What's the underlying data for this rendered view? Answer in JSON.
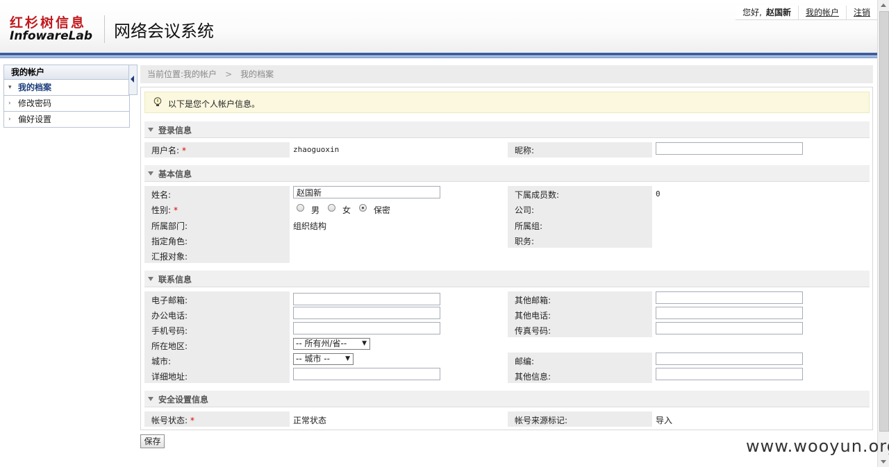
{
  "header": {
    "logo_cn": "红杉树信息",
    "logo_en": "InfowareLab",
    "system_title": "网络会议系统",
    "greeting": "您好,",
    "user_name": "赵国新",
    "my_account_link": "我的帐户",
    "logout_link": "注销"
  },
  "sidebar": {
    "title": "我的帐户",
    "items": [
      {
        "label": "我的档案",
        "active": true
      },
      {
        "label": "修改密码",
        "active": false
      },
      {
        "label": "偏好设置",
        "active": false
      }
    ]
  },
  "breadcrumb": {
    "prefix": "当前位置:",
    "level1": "我的帐户",
    "level2": "我的档案"
  },
  "notice": {
    "text": "以下是您个人帐户信息。"
  },
  "sections": {
    "login": "登录信息",
    "basic": "基本信息",
    "contact": "联系信息",
    "security": "安全设置信息"
  },
  "login": {
    "username_label": "用户名:",
    "username_value": "zhaoguoxin",
    "nickname_label": "昵称:",
    "nickname_value": ""
  },
  "basic": {
    "name_label": "姓名:",
    "name_value": "赵国新",
    "gender_label": "性别:",
    "gender_options": [
      "男",
      "女",
      "保密"
    ],
    "gender_selected": "保密",
    "department_label": "所属部门:",
    "department_value": "组织结构",
    "role_label": "指定角色:",
    "report_label": "汇报对象:",
    "subordinates_label": "下属成员数:",
    "subordinates_value": "0",
    "company_label": "公司:",
    "group_label": "所属组:",
    "position_label": "职务:"
  },
  "contact": {
    "email_label": "电子邮箱:",
    "office_phone_label": "办公电话:",
    "mobile_label": "手机号码:",
    "region_label": "所在地区:",
    "region_select": "-- 所有州/省--",
    "city_label": "城市:",
    "city_select": "-- 城市 --",
    "address_label": "详细地址:",
    "other_email_label": "其他邮箱:",
    "other_phone_label": "其他电话:",
    "fax_label": "传真号码:",
    "postcode_label": "邮编:",
    "other_info_label": "其他信息:"
  },
  "security": {
    "status_label": "帐号状态:",
    "status_value": "正常状态",
    "source_label": "帐号来源标记:",
    "source_value": "导入"
  },
  "save_label": "保存",
  "watermark": "www.wooyun.org",
  "colors": {
    "required": "#dd0000",
    "header_stripe": "#3b5fa0",
    "logo_red": "#c0191e"
  }
}
